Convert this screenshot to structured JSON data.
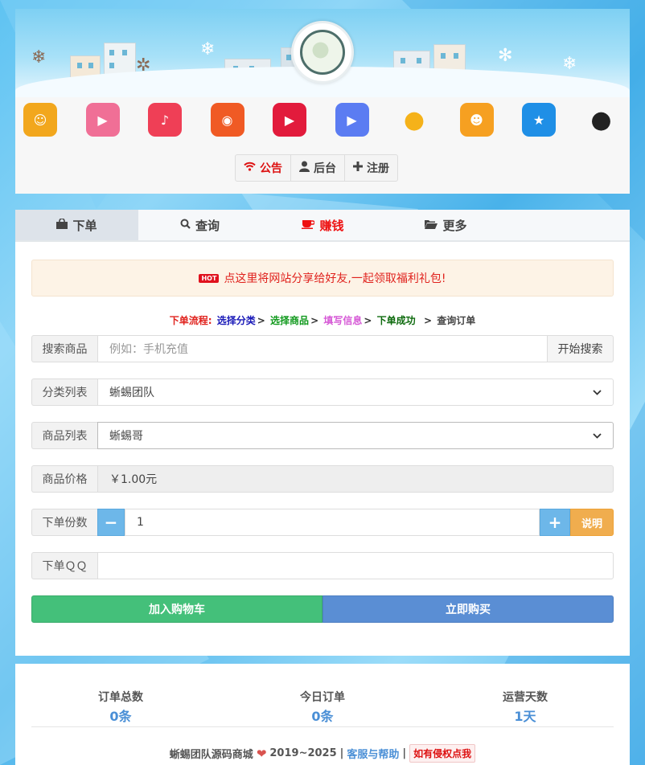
{
  "header": {
    "app_icons": [
      {
        "name": "changba-icon",
        "color": "#f2a71d"
      },
      {
        "name": "bilibili-icon",
        "color": "#f06f96"
      },
      {
        "name": "music-icon",
        "color": "#ef3f56"
      },
      {
        "name": "ting-icon",
        "color": "#f05a24"
      },
      {
        "name": "video-play-icon",
        "color": "#e21b3c"
      },
      {
        "name": "tencent-video-icon",
        "color": "#5b7cf2"
      },
      {
        "name": "qq-penguin-icon",
        "color": "#f5b21a"
      },
      {
        "name": "qq-show-icon",
        "color": "#f6a021"
      },
      {
        "name": "qzone-icon",
        "color": "#1f8fe6"
      },
      {
        "name": "qq-icon",
        "color": "#222222"
      }
    ],
    "buttons": {
      "notice": "公告",
      "admin": "后台",
      "register": "注册"
    }
  },
  "tabs": {
    "order": "下单",
    "query": "查询",
    "earn": "赚钱",
    "more": "更多"
  },
  "notice": {
    "hot": "HOT",
    "text": "点这里将网站分享给好友,一起领取福利礼包!"
  },
  "flow": {
    "label": "下单流程:",
    "step1": "选择分类",
    "step2": "选择商品",
    "step3": "填写信息",
    "step4": "下单成功",
    "step5": "查询订单",
    "arrow": ">"
  },
  "form": {
    "search": {
      "label": "搜索商品",
      "placeholder": "例如：手机充值",
      "button": "开始搜索"
    },
    "category": {
      "label": "分类列表",
      "value": "蜥蜴团队"
    },
    "product": {
      "label": "商品列表",
      "value": "蜥蜴哥"
    },
    "price": {
      "label": "商品价格",
      "value": "￥1.00元"
    },
    "quantity": {
      "label": "下单份数",
      "value": "1",
      "minus": "−",
      "plus": "+",
      "explain": "说明"
    },
    "qq": {
      "label": "下单ＱＱ",
      "value": ""
    },
    "add_cart": "加入购物车",
    "buy_now": "立即购买"
  },
  "stats": {
    "total_orders": {
      "title": "订单总数",
      "value": "0条"
    },
    "today_orders": {
      "title": "今日订单",
      "value": "0条"
    },
    "days": {
      "title": "运营天数",
      "value": "1天"
    }
  },
  "footer": {
    "brand": "蜥蜴团队源码商城",
    "years": "2019~2025",
    "sep": "|",
    "help": "客服与帮助",
    "report": "如有侵权点我"
  },
  "colors": {
    "accent_blue": "#4a8fd6",
    "green": "#44c07a",
    "red": "#e0221d",
    "orange": "#f0ad4e"
  }
}
